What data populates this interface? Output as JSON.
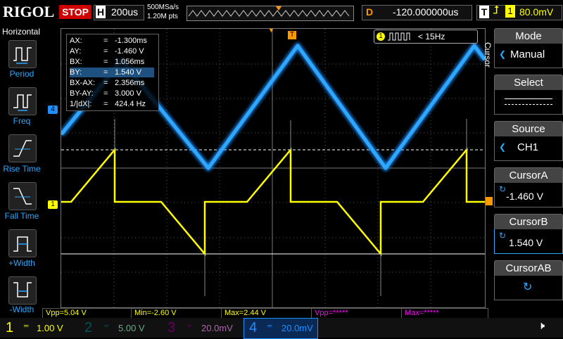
{
  "brand": "RIGOL",
  "run_state": "STOP",
  "horizontal": {
    "letter": "H",
    "timebase": "200us",
    "sample_rate": "500MSa/s",
    "points": "1.20M pts"
  },
  "delay": {
    "letter": "D",
    "value": "-120.000000us"
  },
  "trigger": {
    "letter": "T",
    "channel": "1",
    "level": "80.0mV"
  },
  "left_menu": {
    "title": "Horizontal",
    "items": [
      {
        "label": "Period"
      },
      {
        "label": "Freq"
      },
      {
        "label": "Rise Time"
      },
      {
        "label": "Fall Time"
      },
      {
        "label": "+Width"
      },
      {
        "label": "-Width"
      }
    ]
  },
  "cursor_info": [
    {
      "key": "AX:",
      "value": "-1.300ms"
    },
    {
      "key": "AY:",
      "value": "-1.460 V"
    },
    {
      "key": "BX:",
      "value": "1.056ms"
    },
    {
      "key": "BY:",
      "value": "1.540 V"
    },
    {
      "key": "BX-AX:",
      "value": "2.356ms"
    },
    {
      "key": "BY-AY:",
      "value": "3.000 V"
    },
    {
      "key": "1/|dX|:",
      "value": "424.4 Hz"
    }
  ],
  "freq_counter": {
    "channel": "1",
    "value": "< 15Hz"
  },
  "channel_markers": {
    "ch1": "1",
    "ch4": "4",
    "trigger": "T"
  },
  "measurements": [
    "Vpp=5.04 V",
    "Min=-2.60 V",
    "Max=2.44 V",
    "Vpp=*****",
    "Max=*****"
  ],
  "channels": [
    {
      "num": "1",
      "scale": "1.00 V",
      "color": "#ffff00"
    },
    {
      "num": "2",
      "scale": "5.00 V",
      "color": "#00e0e0"
    },
    {
      "num": "3",
      "scale": "20.0mV",
      "color": "#ff00ff"
    },
    {
      "num": "4",
      "scale": "20.0mV",
      "color": "#1e8fff"
    }
  ],
  "right_menu": {
    "vertical_label": "Cursor",
    "items": [
      {
        "title": "Mode",
        "value": "Manual"
      },
      {
        "title": "Select",
        "value": ""
      },
      {
        "title": "Source",
        "value": "CH1"
      },
      {
        "title": "CursorA",
        "value": "-1.460 V"
      },
      {
        "title": "CursorB",
        "value": "1.540 V"
      },
      {
        "title": "CursorAB",
        "value": ""
      }
    ]
  },
  "colors": {
    "ch1": "#ffff00",
    "ch4": "#1e8fff",
    "stop": "#d10000",
    "trigger": "#ff9900",
    "menu_accent": "#29a8ff"
  }
}
